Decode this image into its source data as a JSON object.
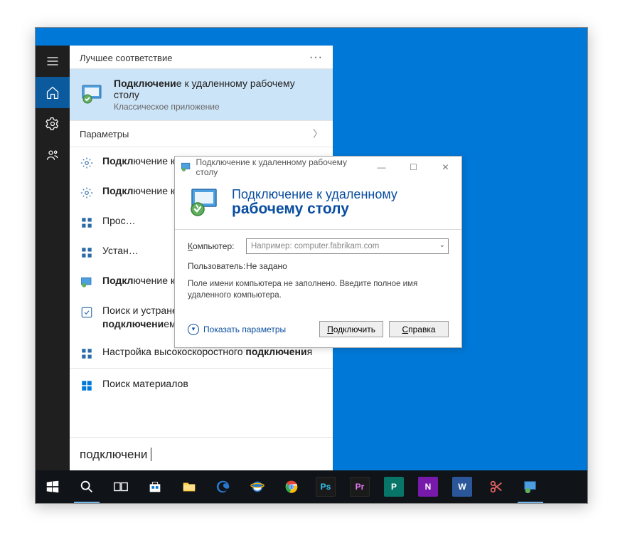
{
  "colors": {
    "desktop": "#0078d7",
    "accent": "#0a4ea0",
    "highlight": "#cce4f7"
  },
  "rail": {
    "items": [
      "menu",
      "home",
      "settings",
      "people"
    ]
  },
  "start": {
    "best_header": "Лучшее соответствие",
    "best_title_pre": "Подключени",
    "best_title_post": "е к удаленному рабочему столу",
    "best_subtitle": "Классическое приложение",
    "params_header": "Параметры",
    "items": [
      {
        "pre": "Подкл",
        "post": "ючение к рабочим или учебным компьютерам"
      },
      {
        "pre": "Подкл",
        "post": "ючение к домену"
      },
      {
        "pre": "",
        "post": "Просмотр подключений"
      },
      {
        "pre": "",
        "post": "Установка VPN"
      },
      {
        "pre": "Подкл",
        "post": "ючение к удаленному рабочему столу"
      },
      {
        "pre": "",
        "post_b1": "Поиск и устранение проблем с сетью и ",
        "bold": "подключени",
        "post_b2": "ем"
      },
      {
        "pre": "",
        "post_b1": "Настройка высокоскоростного ",
        "bold": "подключени",
        "post_b2": "я"
      }
    ],
    "store_label": "Поиск материалов",
    "search_text": "подключени"
  },
  "rdp": {
    "title": "Подключение к удаленному рабочему столу",
    "head1": "Подключение к удаленному",
    "head2": "рабочему столу",
    "label_computer": "Компьютер:",
    "label_computer_u": "К",
    "combo_placeholder": "Например: computer.fabrikam.com",
    "label_user": "Пользователь:",
    "user_value": "Не задано",
    "note": "Поле имени компьютера не заполнено. Введите полное имя удаленного компьютера.",
    "show_params": "Показать параметры",
    "show_params_u": "П",
    "btn_connect_u": "П",
    "btn_connect": "одключить",
    "btn_help_u": "С",
    "btn_help": "правка"
  },
  "taskbar": {
    "items": [
      "start",
      "search",
      "taskview",
      "store",
      "files",
      "edge",
      "ie",
      "chrome",
      "ps",
      "pr",
      "publisher",
      "onenote",
      "word",
      "snip",
      "rdp"
    ]
  }
}
